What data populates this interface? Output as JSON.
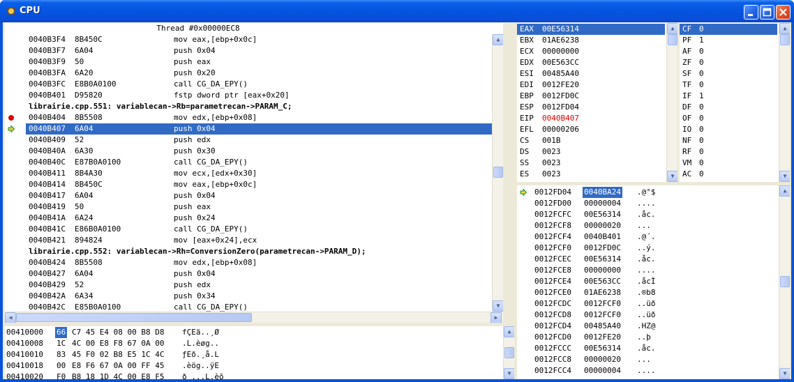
{
  "window": {
    "title": "CPU"
  },
  "disasm": {
    "thread_label": "Thread #0x00000EC8",
    "lines": [
      {
        "addr": "0040B3F4",
        "bytes": "8B450C",
        "instr": "mov eax,[ebp+0x0c]"
      },
      {
        "addr": "0040B3F7",
        "bytes": "6A04",
        "instr": "push 0x04"
      },
      {
        "addr": "0040B3F9",
        "bytes": "50",
        "instr": "push eax"
      },
      {
        "addr": "0040B3FA",
        "bytes": "6A20",
        "instr": "push 0x20"
      },
      {
        "addr": "0040B3FC",
        "bytes": "E8B0A0100",
        "instr": "call CG_DA_EPY()"
      },
      {
        "addr": "0040B401",
        "bytes": "D95820",
        "instr": "fstp dword ptr [eax+0x20]"
      },
      {
        "source": "librairie.cpp.551: variablecan->Rb=parametrecan->PARAM_C;"
      },
      {
        "addr": "0040B404",
        "bytes": "8B5508",
        "instr": "mov edx,[ebp+0x08]",
        "marker": "breakpoint"
      },
      {
        "addr": "0040B407",
        "bytes": "6A04",
        "instr": "push 0x04",
        "marker": "current",
        "selected": true
      },
      {
        "addr": "0040B409",
        "bytes": "52",
        "instr": "push edx"
      },
      {
        "addr": "0040B40A",
        "bytes": "6A30",
        "instr": "push 0x30"
      },
      {
        "addr": "0040B40C",
        "bytes": "E87B0A0100",
        "instr": "call CG_DA_EPY()"
      },
      {
        "addr": "0040B411",
        "bytes": "8B4A30",
        "instr": "mov ecx,[edx+0x30]"
      },
      {
        "addr": "0040B414",
        "bytes": "8B450C",
        "instr": "mov eax,[ebp+0x0c]"
      },
      {
        "addr": "0040B417",
        "bytes": "6A04",
        "instr": "push 0x04"
      },
      {
        "addr": "0040B419",
        "bytes": "50",
        "instr": "push eax"
      },
      {
        "addr": "0040B41A",
        "bytes": "6A24",
        "instr": "push 0x24"
      },
      {
        "addr": "0040B41C",
        "bytes": "E86B0A0100",
        "instr": "call CG_DA_EPY()"
      },
      {
        "addr": "0040B421",
        "bytes": "894824",
        "instr": "mov [eax+0x24],ecx"
      },
      {
        "source": "librairie.cpp.552: variablecan->Rh=ConversionZero(parametrecan->PARAM_D);"
      },
      {
        "addr": "0040B424",
        "bytes": "8B5508",
        "instr": "mov edx,[ebp+0x08]"
      },
      {
        "addr": "0040B427",
        "bytes": "6A04",
        "instr": "push 0x04"
      },
      {
        "addr": "0040B429",
        "bytes": "52",
        "instr": "push edx"
      },
      {
        "addr": "0040B42A",
        "bytes": "6A34",
        "instr": "push 0x34"
      },
      {
        "addr": "0040B42C",
        "bytes": "E85B0A0100",
        "instr": "call CG_DA_EPY()"
      }
    ]
  },
  "registers": [
    {
      "name": "EAX",
      "value": "00E56314",
      "selected": true
    },
    {
      "name": "EBX",
      "value": "01AE6238"
    },
    {
      "name": "ECX",
      "value": "00000000"
    },
    {
      "name": "EDX",
      "value": "00E563CC"
    },
    {
      "name": "ESI",
      "value": "00485A40"
    },
    {
      "name": "EDI",
      "value": "0012FE20"
    },
    {
      "name": "EBP",
      "value": "0012FD0C"
    },
    {
      "name": "ESP",
      "value": "0012FD04"
    },
    {
      "name": "EIP",
      "value": "0040B407",
      "changed": true
    },
    {
      "name": "EFL",
      "value": "00000206"
    },
    {
      "name": "CS",
      "value": "001B"
    },
    {
      "name": "DS",
      "value": "0023"
    },
    {
      "name": "SS",
      "value": "0023"
    },
    {
      "name": "ES",
      "value": "0023"
    }
  ],
  "flags": [
    {
      "name": "CF",
      "value": "0",
      "selected": true
    },
    {
      "name": "PF",
      "value": "1"
    },
    {
      "name": "AF",
      "value": "0"
    },
    {
      "name": "ZF",
      "value": "0"
    },
    {
      "name": "SF",
      "value": "0"
    },
    {
      "name": "TF",
      "value": "0"
    },
    {
      "name": "IF",
      "value": "1"
    },
    {
      "name": "DF",
      "value": "0"
    },
    {
      "name": "OF",
      "value": "0"
    },
    {
      "name": "IO",
      "value": "0"
    },
    {
      "name": "NF",
      "value": "0"
    },
    {
      "name": "RF",
      "value": "0"
    },
    {
      "name": "VM",
      "value": "0"
    },
    {
      "name": "AC",
      "value": "0"
    }
  ],
  "memory": [
    {
      "addr": "00410000",
      "first": "66",
      "rest": "C7 45 E4 08 00 B8 D8",
      "ascii": "fÇEä..¸Ø"
    },
    {
      "addr": "00410008",
      "first": "1C",
      "rest": "4C 00 E8 F8 67 0A 00",
      "ascii": ".L.èøg.."
    },
    {
      "addr": "00410010",
      "first": "83",
      "rest": "45 F0 02 B8 E5 1C 4C",
      "ascii": "ƒEð.¸å.L"
    },
    {
      "addr": "00410018",
      "first": "00",
      "rest": "E8 F6 67 0A 00 FF 45",
      "ascii": ".èög..ÿE"
    },
    {
      "addr": "00410020",
      "first": "F0",
      "rest": "B8 18 1D 4C 00 E8 F5",
      "ascii": "ð¸...L.èõ"
    }
  ],
  "stack": [
    {
      "addr": "0012FD04",
      "value": "0040BA24",
      "ascii": ".@°$",
      "marker": "current",
      "selected": true
    },
    {
      "addr": "0012FD00",
      "value": "00000004",
      "ascii": "...."
    },
    {
      "addr": "0012FCFC",
      "value": "00E56314",
      "ascii": ".åc."
    },
    {
      "addr": "0012FCF8",
      "value": "00000020",
      "ascii": "... "
    },
    {
      "addr": "0012FCF4",
      "value": "0040B401",
      "ascii": ".@´."
    },
    {
      "addr": "0012FCF0",
      "value": "0012FD0C",
      "ascii": "..ý."
    },
    {
      "addr": "0012FCEC",
      "value": "00E56314",
      "ascii": ".åc."
    },
    {
      "addr": "0012FCE8",
      "value": "00000000",
      "ascii": "...."
    },
    {
      "addr": "0012FCE4",
      "value": "00E563CC",
      "ascii": ".åcÌ"
    },
    {
      "addr": "0012FCE0",
      "value": "01AE6238",
      "ascii": ".®b8"
    },
    {
      "addr": "0012FCDC",
      "value": "0012FCF0",
      "ascii": "..üð"
    },
    {
      "addr": "0012FCD8",
      "value": "0012FCF0",
      "ascii": "..üð"
    },
    {
      "addr": "0012FCD4",
      "value": "00485A40",
      "ascii": ".HZ@"
    },
    {
      "addr": "0012FCD0",
      "value": "0012FE20",
      "ascii": "..þ "
    },
    {
      "addr": "0012FCCC",
      "value": "00E56314",
      "ascii": ".åc."
    },
    {
      "addr": "0012FCC8",
      "value": "00000020",
      "ascii": "... "
    },
    {
      "addr": "0012FCC4",
      "value": "00000004",
      "ascii": "...."
    }
  ],
  "colors": {
    "selection": "#316ac5",
    "changed": "#e00000",
    "breakpoint": "#e00000",
    "current_arrow": "#1e8f1e"
  }
}
